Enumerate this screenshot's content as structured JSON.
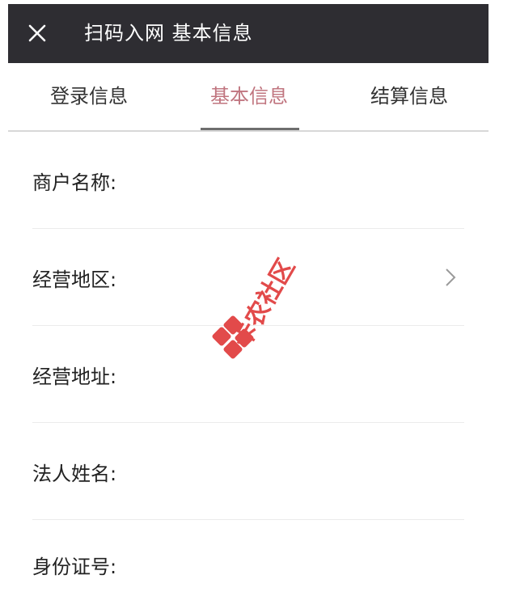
{
  "header": {
    "title": "扫码入网 基本信息",
    "close_icon": "close-icon",
    "background": "#2e2d32"
  },
  "tabs": [
    {
      "label": "登录信息",
      "active": false
    },
    {
      "label": "基本信息",
      "active": true
    },
    {
      "label": "结算信息",
      "active": false
    }
  ],
  "colors": {
    "active_tab": "#c0757f",
    "watermark": "#e24a4a"
  },
  "form": {
    "fields": [
      {
        "label": "商户名称:",
        "value": ""
      },
      {
        "label": "经营地区:",
        "value": "",
        "icon": "chevron-right-icon"
      },
      {
        "label": "经营地址:",
        "value": ""
      },
      {
        "label": "法人姓名:",
        "value": ""
      },
      {
        "label": "身份证号:",
        "value": ""
      }
    ]
  },
  "watermark": {
    "text": "卡农社区",
    "icon": "kanong-logo-icon"
  }
}
